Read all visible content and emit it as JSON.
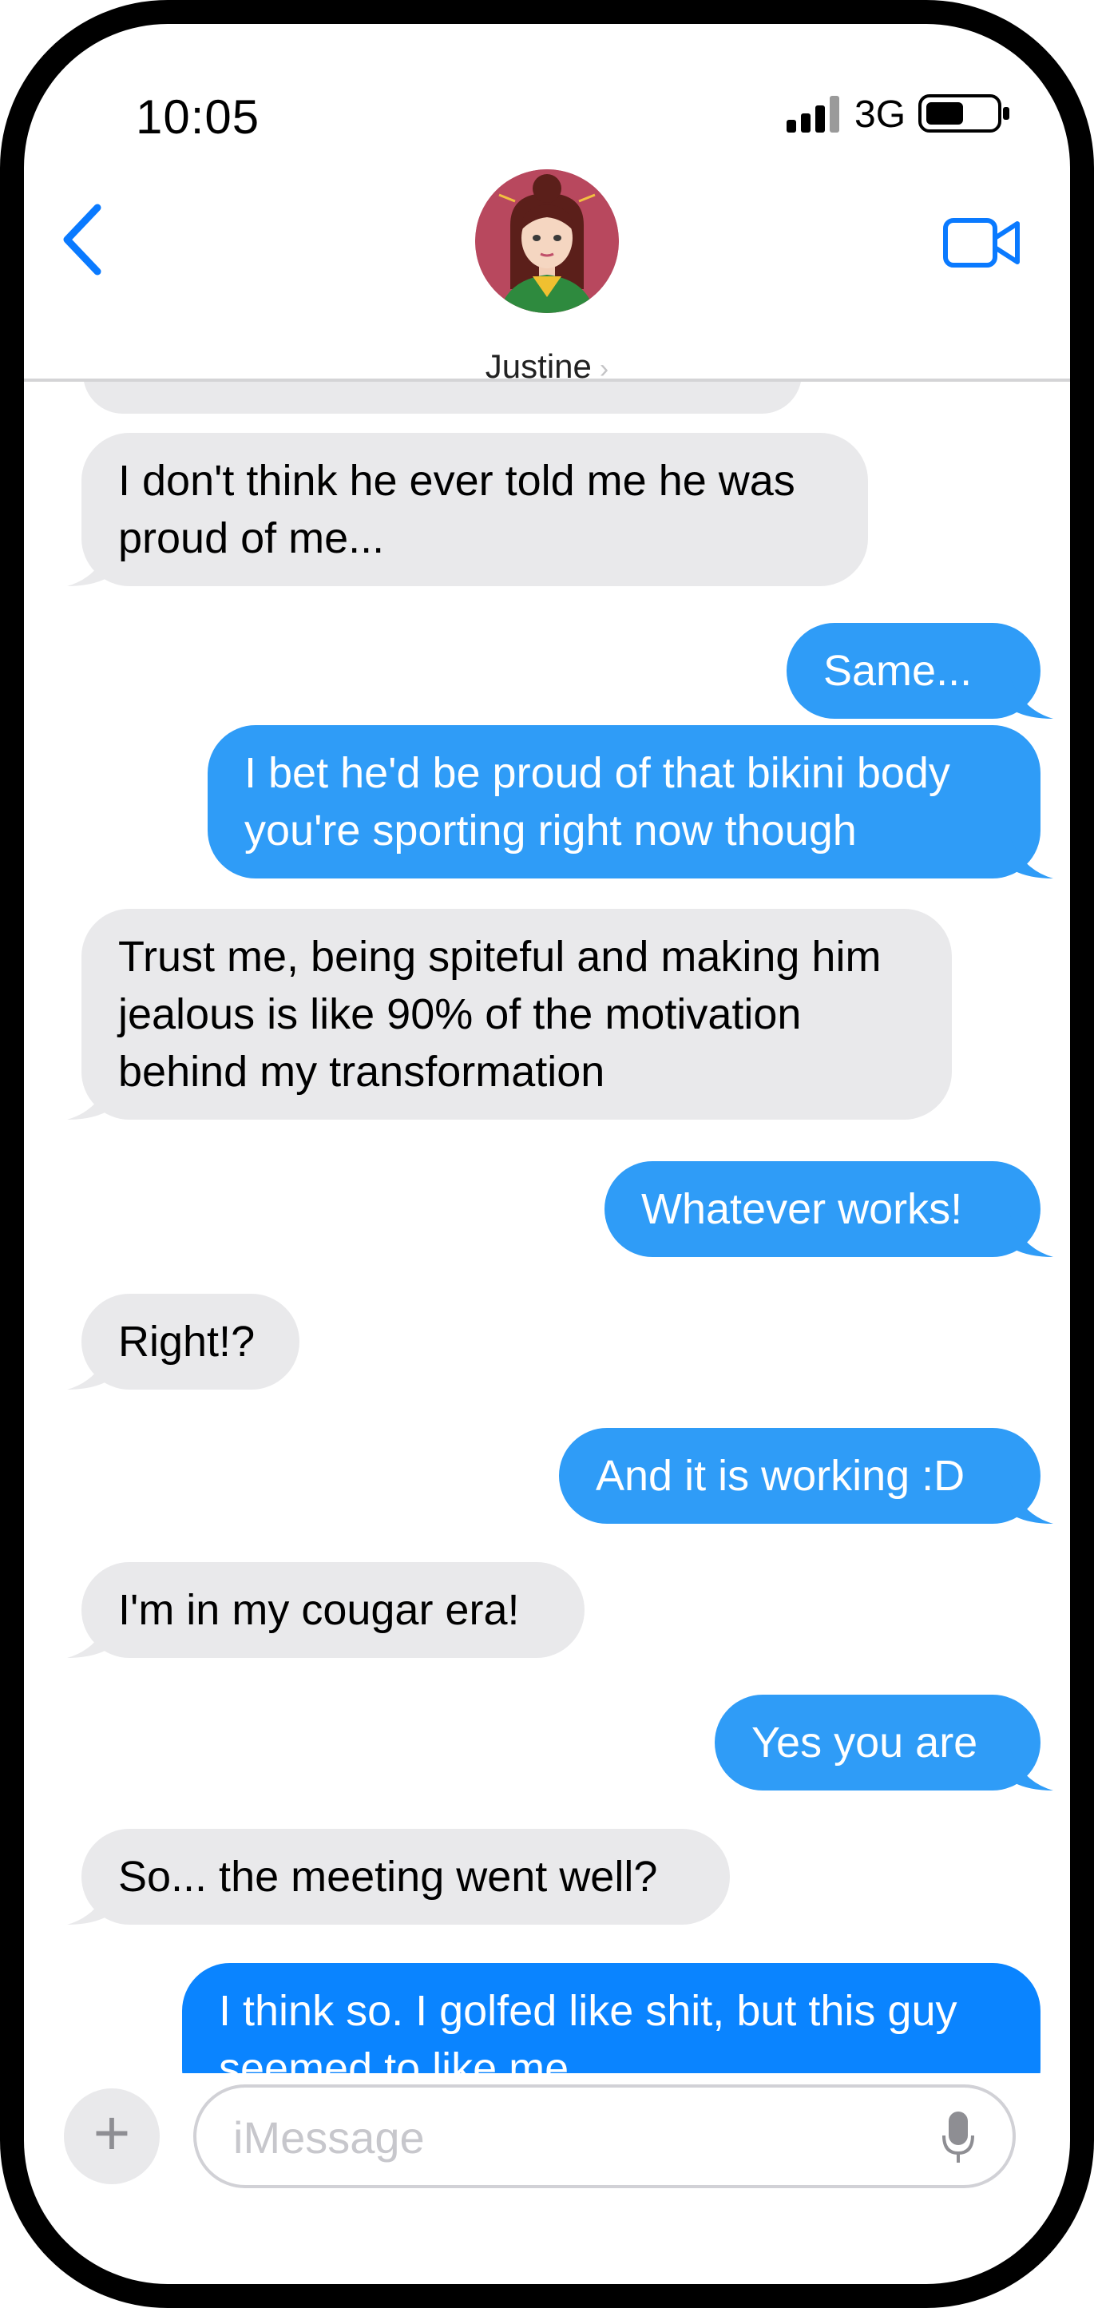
{
  "status_bar": {
    "time": "10:05",
    "network": "3G"
  },
  "header": {
    "contact_name": "Justine",
    "back_icon": "chevron-left-icon",
    "video_icon": "video-camera-icon",
    "accent_color": "#0a7aff"
  },
  "messages": [
    {
      "direction": "incoming",
      "lines": [
        "I don't think he ever told me he was",
        "proud of me..."
      ]
    },
    {
      "direction": "outgoing",
      "lines": [
        "Same..."
      ]
    },
    {
      "direction": "outgoing",
      "lines": [
        "I bet he'd be proud of that bikini body",
        "you're sporting right now though"
      ]
    },
    {
      "direction": "incoming",
      "lines": [
        "Trust me, being spiteful and making him",
        "jealous is like 90% of the motivation",
        "behind my transformation"
      ]
    },
    {
      "direction": "outgoing",
      "lines": [
        "Whatever works!"
      ]
    },
    {
      "direction": "incoming",
      "lines": [
        "Right!?"
      ]
    },
    {
      "direction": "outgoing",
      "lines": [
        "And it is working :D"
      ]
    },
    {
      "direction": "incoming",
      "lines": [
        "I'm in my cougar era!"
      ]
    },
    {
      "direction": "outgoing",
      "lines": [
        "Yes you are"
      ]
    },
    {
      "direction": "incoming",
      "lines": [
        "So... the meeting went well?"
      ]
    },
    {
      "direction": "outgoing",
      "lines": [
        "I think so.  I golfed like shit, but this guy",
        "seemed to like me"
      ]
    }
  ],
  "input_bar": {
    "plus_label": "+",
    "placeholder": "iMessage",
    "mic_icon": "microphone-icon"
  },
  "colors": {
    "incoming_bubble": "#e9e9eb",
    "outgoing_bubble": "#2f9cf7",
    "last_outgoing_bubble": "#0a84ff"
  }
}
